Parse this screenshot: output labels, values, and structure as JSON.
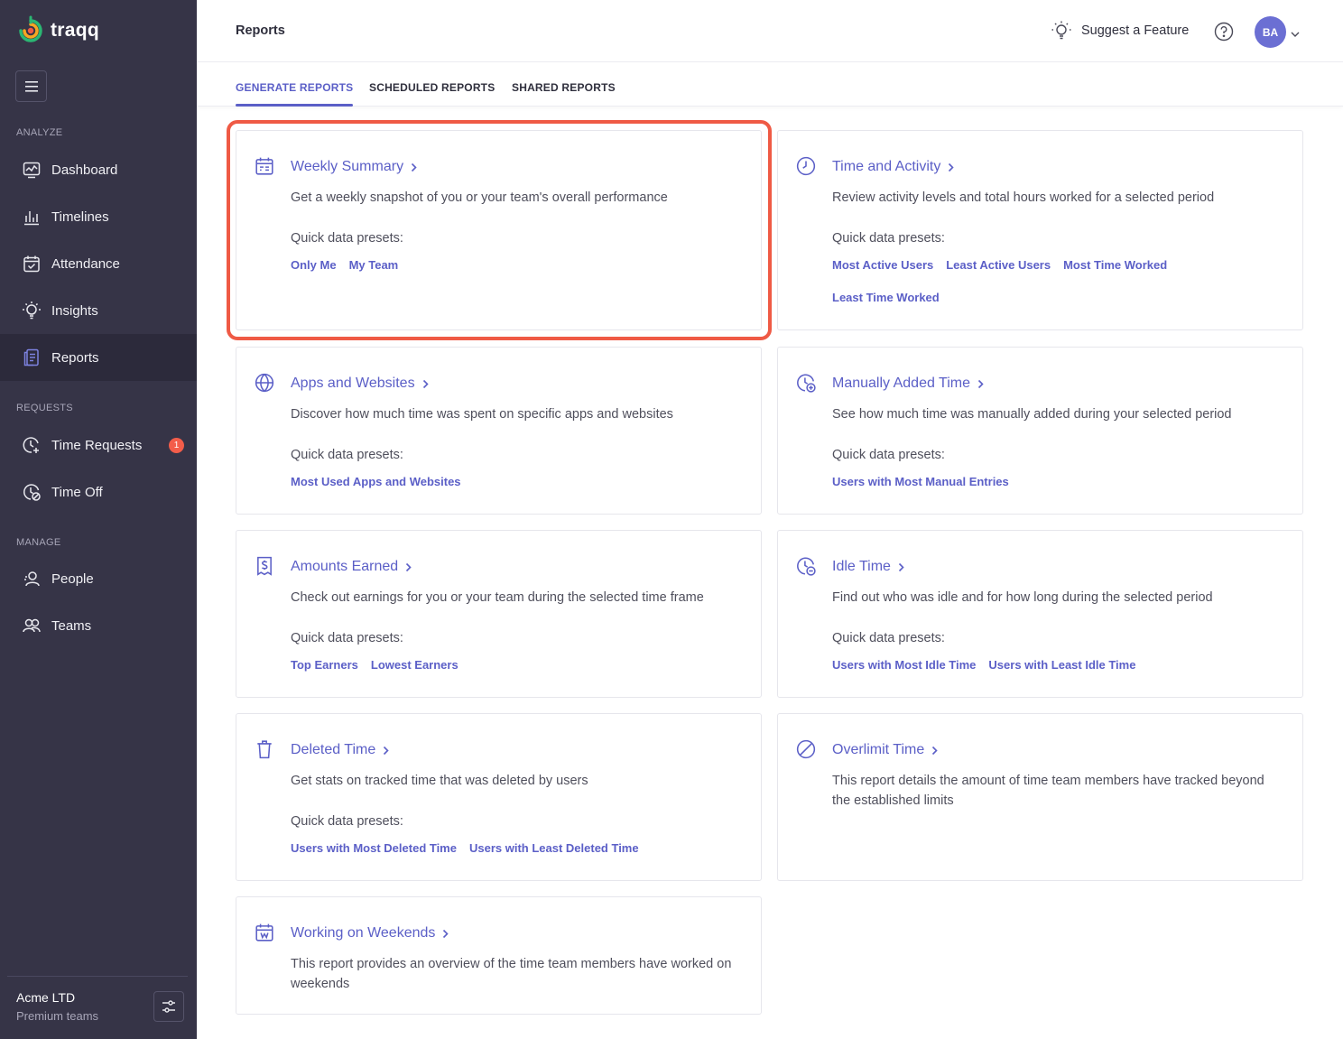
{
  "brand": {
    "name": "traqq"
  },
  "sidebar": {
    "sections": {
      "analyze": "ANALYZE",
      "requests": "REQUESTS",
      "manage": "MANAGE"
    },
    "items": [
      {
        "label": "Dashboard",
        "icon": "dashboard-icon"
      },
      {
        "label": "Timelines",
        "icon": "timelines-icon"
      },
      {
        "label": "Attendance",
        "icon": "attendance-icon"
      },
      {
        "label": "Insights",
        "icon": "insights-icon"
      },
      {
        "label": "Reports",
        "icon": "reports-icon",
        "active": true
      },
      {
        "label": "Time Requests",
        "icon": "time-requests-icon",
        "badge": "1"
      },
      {
        "label": "Time Off",
        "icon": "time-off-icon"
      },
      {
        "label": "People",
        "icon": "people-icon"
      },
      {
        "label": "Teams",
        "icon": "teams-icon"
      }
    ],
    "org": {
      "name": "Acme LTD",
      "plan": "Premium teams"
    }
  },
  "header": {
    "title": "Reports",
    "suggest_label": "Suggest a Feature",
    "avatar_initials": "BA"
  },
  "tabs": [
    {
      "label": "GENERATE REPORTS",
      "active": true
    },
    {
      "label": "SCHEDULED REPORTS"
    },
    {
      "label": "SHARED REPORTS"
    }
  ],
  "preset_label": "Quick data presets:",
  "cards": [
    {
      "title": "Weekly Summary",
      "icon": "calendar-summary-icon",
      "desc": "Get a weekly snapshot of you or your team's overall performance",
      "presets": [
        "Only Me",
        "My Team"
      ]
    },
    {
      "title": "Time and Activity",
      "icon": "clock-icon",
      "desc": "Review activity levels and total hours worked for a selected period",
      "presets": [
        "Most Active Users",
        "Least Active Users",
        "Most Time Worked",
        "Least Time Worked"
      ]
    },
    {
      "title": "Apps and Websites",
      "icon": "globe-icon",
      "desc": "Discover how much time was spent on specific apps and websites",
      "presets": [
        "Most Used Apps and Websites"
      ]
    },
    {
      "title": "Manually Added Time",
      "icon": "clock-plus-icon",
      "desc": "See how much time was manually added during your selected period",
      "presets": [
        "Users with Most Manual Entries"
      ]
    },
    {
      "title": "Amounts Earned",
      "icon": "receipt-dollar-icon",
      "desc": "Check out earnings for you or your team during the selected time frame",
      "presets": [
        "Top Earners",
        "Lowest Earners"
      ]
    },
    {
      "title": "Idle Time",
      "icon": "clock-minus-icon",
      "desc": "Find out who was idle and for how long during the selected period",
      "presets": [
        "Users with Most Idle Time",
        "Users with Least Idle Time"
      ]
    },
    {
      "title": "Deleted Time",
      "icon": "trash-icon",
      "desc": "Get stats on tracked time that was deleted by users",
      "presets": [
        "Users with Most Deleted Time",
        "Users with Least Deleted Time"
      ]
    },
    {
      "title": "Overlimit Time",
      "icon": "prohibited-icon",
      "desc": "This report details the amount of time team members have tracked beyond the established limits",
      "presets": []
    },
    {
      "title": "Working on Weekends",
      "icon": "calendar-weekend-icon",
      "desc": "This report provides an overview of the time team members have worked on weekends",
      "presets": []
    }
  ],
  "colors": {
    "accent": "#5b5fc7",
    "sidebar": "#363447",
    "highlight": "#ef5a45",
    "badge": "#f35d4a"
  }
}
